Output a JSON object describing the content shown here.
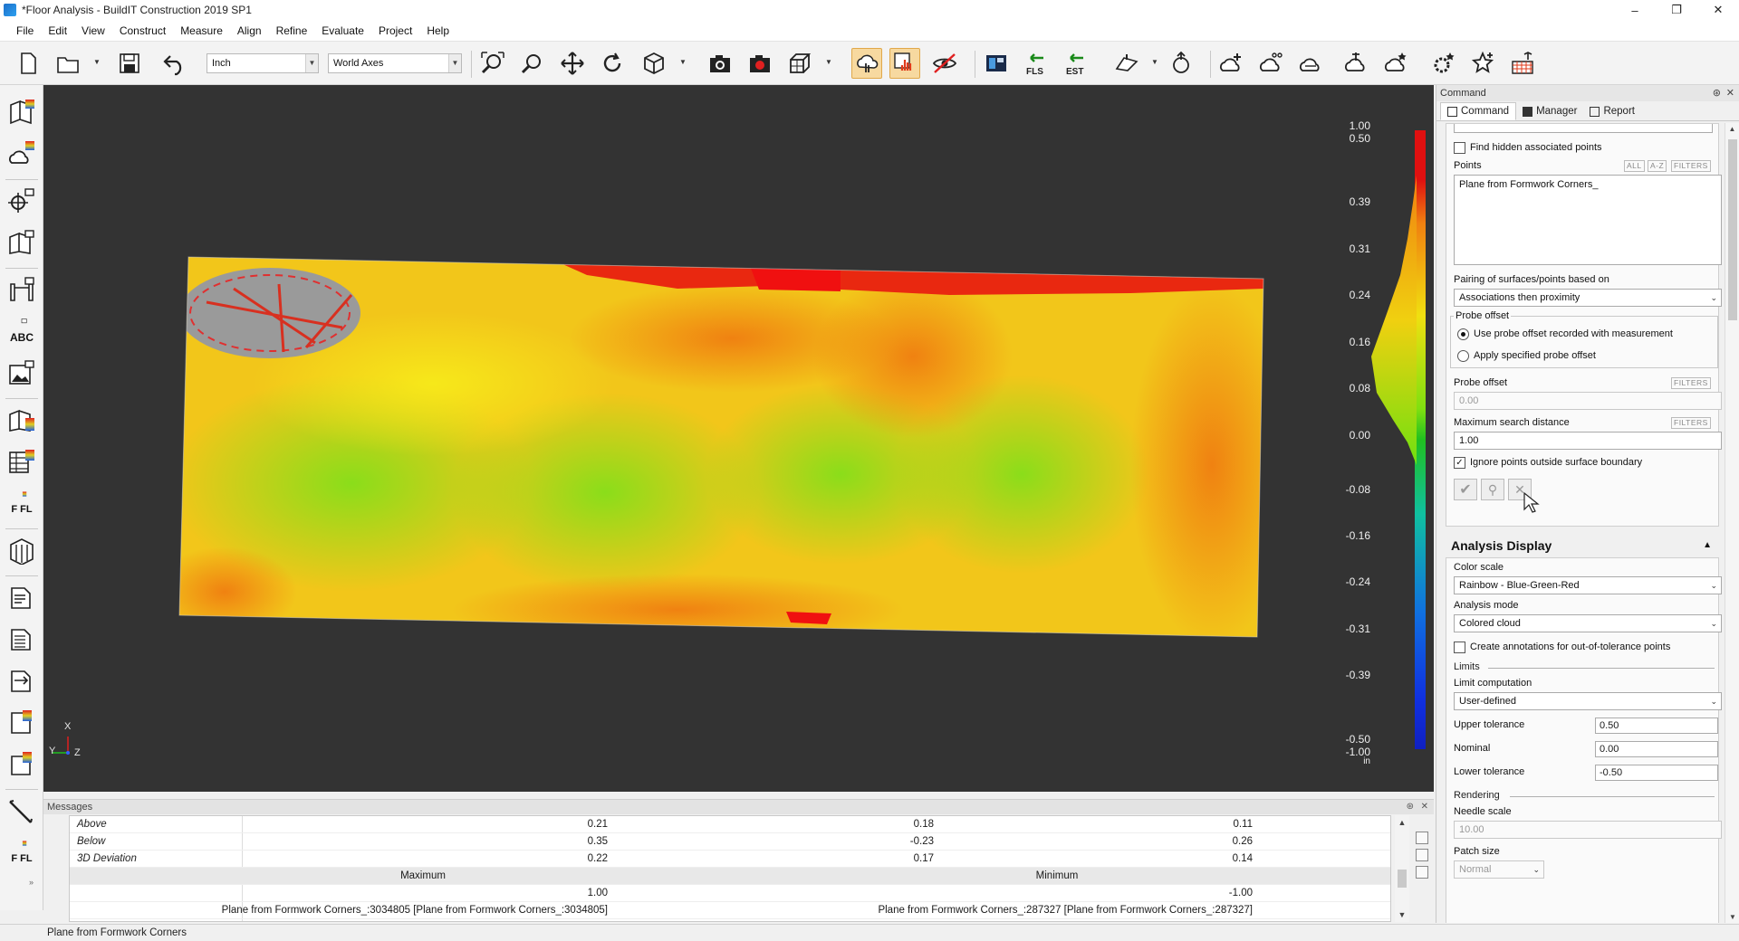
{
  "window": {
    "title": "*Floor Analysis - BuildIT Construction 2019 SP1"
  },
  "menu": [
    "File",
    "Edit",
    "View",
    "Construct",
    "Measure",
    "Align",
    "Refine",
    "Evaluate",
    "Project",
    "Help"
  ],
  "toolbar": {
    "units": "Inch",
    "coordinate_system": "World Axes",
    "fls_label": "FLS",
    "est_label": "EST"
  },
  "lefttools": {
    "abc_label": "ABC",
    "ffl_label_1": "F FL",
    "ffl_label_2": "F FL"
  },
  "viewport": {
    "scale_labels": [
      "1.00",
      "0.50",
      "0.39",
      "0.31",
      "0.24",
      "0.16",
      "0.08",
      "0.00",
      "-0.08",
      "-0.16",
      "-0.24",
      "-0.31",
      "-0.39",
      "-0.50",
      "-1.00"
    ],
    "units": "in",
    "axis_x": "X",
    "axis_y": "Y",
    "axis_z": "Z"
  },
  "messages": {
    "title": "Messages",
    "rows": [
      {
        "label": "Above",
        "v1": "0.21",
        "v2": "0.18",
        "v3": "0.11"
      },
      {
        "label": "Below",
        "v1": "0.35",
        "v2": "-0.23",
        "v3": "0.26"
      },
      {
        "label": "3D Deviation",
        "v1": "0.22",
        "v2": "0.17",
        "v3": "0.14"
      }
    ],
    "max_header": "Maximum",
    "min_header": "Minimum",
    "max_value": "1.00",
    "min_value": "-1.00",
    "max_point": "Plane from Formwork Corners_:3034805 [Plane from Formwork Corners_:3034805]",
    "min_point": "Plane from Formwork Corners_:287327 [Plane from Formwork Corners_:287327]"
  },
  "statusbar": {
    "text": "Plane from Formwork Corners"
  },
  "panel": {
    "title": "Command",
    "tabs": [
      "Command",
      "Manager",
      "Report"
    ],
    "find_hidden_label": "Find hidden associated points",
    "points_label": "Points",
    "points_filters": [
      "ALL",
      "A-Z",
      "FILTERS"
    ],
    "points_value": "Plane from Formwork Corners_",
    "pairing_label": "Pairing of surfaces/points based on",
    "pairing_value": "Associations then proximity",
    "probe_offset_group": "Probe offset",
    "radio_recorded": "Use probe offset recorded with measurement",
    "radio_specified": "Apply specified probe offset",
    "probe_offset_label": "Probe offset",
    "probe_offset_filters": "FILTERS",
    "probe_offset_value": "0.00",
    "max_search_label": "Maximum search distance",
    "max_search_filters": "FILTERS",
    "max_search_value": "1.00",
    "ignore_points_label": "Ignore points outside surface boundary",
    "analysis_display_title": "Analysis Display",
    "color_scale_label": "Color scale",
    "color_scale_value": "Rainbow - Blue-Green-Red",
    "analysis_mode_label": "Analysis mode",
    "analysis_mode_value": "Colored cloud",
    "annotations_label": "Create annotations for out-of-tolerance points",
    "limits_label": "Limits",
    "limit_computation_label": "Limit computation",
    "limit_computation_value": "User-defined",
    "upper_tol_label": "Upper tolerance",
    "upper_tol_value": "0.50",
    "nominal_label": "Nominal",
    "nominal_value": "0.00",
    "lower_tol_label": "Lower tolerance",
    "lower_tol_value": "-0.50",
    "rendering_label": "Rendering",
    "needle_scale_label": "Needle scale",
    "needle_scale_value": "10.00",
    "patch_size_label": "Patch size",
    "patch_size_value": "Normal"
  }
}
